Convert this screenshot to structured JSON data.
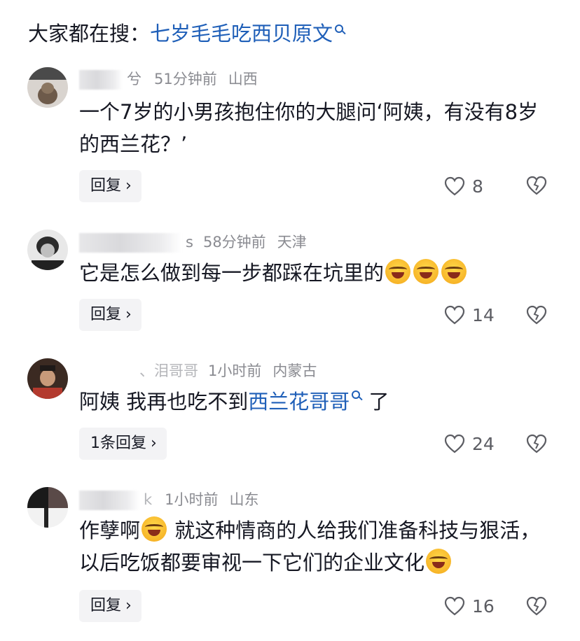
{
  "search": {
    "prefix": "大家都在搜：",
    "query": "七岁毛毛吃西贝原文",
    "icon": "search-icon"
  },
  "comments": [
    {
      "name_tail": "兮",
      "time": "51分钟前",
      "location": "山西",
      "text": "一个7岁的小男孩抱住你的大腿问‘阿姨，有没有8岁的西兰花？’",
      "reply_label": "回复",
      "likes": "8"
    },
    {
      "name_tail": "s",
      "time": "58分钟前",
      "location": "天津",
      "text": "它是怎么做到每一步都踩在坑里的",
      "reply_label": "回复",
      "likes": "14"
    },
    {
      "name_tail": "、泪哥哥",
      "time": "1小时前",
      "location": "内蒙古",
      "text_before": "阿姨 我再也吃不到",
      "text_link": "西兰花哥哥",
      "text_after": " 了",
      "reply_label": "1条回复",
      "likes": "24"
    },
    {
      "name_tail": "k",
      "time": "1小时前",
      "location": "山东",
      "text_a": "作孽啊",
      "text_b": " 就这种情商的人给我们准备科技与狠活，以后吃饭都要审视一下它们的企业文化",
      "reply_label": "回复",
      "likes": "16"
    }
  ],
  "colors": {
    "link": "#1f5fb8",
    "meta": "#8a8b91",
    "reply_bg": "#f3f3f5"
  }
}
